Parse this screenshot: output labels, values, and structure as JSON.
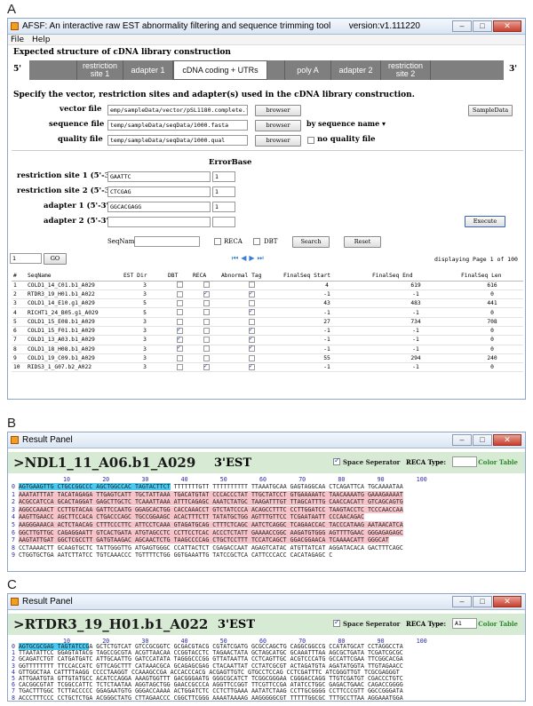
{
  "panel_labels": {
    "a": "A",
    "b": "B",
    "c": "C"
  },
  "afsf": {
    "title": "AFSF: An interactive raw EST abnormality filtering and sequence trimming tool",
    "version": "version:v1.111220",
    "menu": [
      "File",
      "Help"
    ],
    "expected_heading": "Expected structure of cDNA library construction",
    "five_prime": "5'",
    "three_prime": "3'",
    "segments": [
      "restriction site 1",
      "adapter 1",
      "cDNA coding + UTRs",
      "poly A",
      "adapter 2",
      "restriction site 2"
    ],
    "specify_heading": "Specify the vector, restriction sites and adapter(s) used in the cDNA library construction.",
    "vector_label": "vector file",
    "vector_value": "emp/sampleData/vector/pSL1180.complete.fasta",
    "sequence_label": "sequence file",
    "sequence_value": "temp/sampleData/seqData/1000.fasta",
    "quality_label": "quality file",
    "quality_value": "temp/sampleData/seqData/1000.qual",
    "browser": "browser",
    "by_name": "by sequence name",
    "no_quality": "no quality file",
    "sample_data": "SampleData",
    "errorbase": "ErrorBase",
    "rs1_label": "restriction site 1 (5'-3')",
    "rs1_value": "GAATTC",
    "rs1_err": "1",
    "rs2_label": "restriction site 2 (5'-3')",
    "rs2_value": "CTCGAG",
    "rs2_err": "1",
    "ad1_label": "adapter 1 (5'-3')",
    "ad1_value": "GGCACGAGG",
    "ad1_err": "1",
    "ad2_label": "adapter 2 (5'-3')",
    "execute": "Execute",
    "seqname_label": "SeqName",
    "reca": "RECA",
    "dbt": "DBT",
    "search": "Search",
    "reset": "Reset",
    "page_input": "1",
    "go": "GO",
    "display_info": "displaying Page 1 of 100",
    "columns": [
      "#",
      "SeqName",
      "EST Dir",
      "DBT",
      "RECA",
      "Abnormal Tag",
      "FinalSeq Start",
      "FinalSeq End",
      "FinalSeq Len"
    ],
    "rows": [
      {
        "n": "1",
        "name": "COLD1_14_C01.b1_A029",
        "dir": "3",
        "dbt": false,
        "reca": false,
        "ab": false,
        "start": "4",
        "end": "619",
        "len": "616"
      },
      {
        "n": "2",
        "name": "RTDR3_19_H01.b1_A022",
        "dir": "3",
        "dbt": false,
        "reca": true,
        "ab": true,
        "start": "-1",
        "end": "-1",
        "len": "0"
      },
      {
        "n": "3",
        "name": "COLD1_14_E10.g1_A029",
        "dir": "5",
        "dbt": false,
        "reca": false,
        "ab": false,
        "start": "43",
        "end": "483",
        "len": "441"
      },
      {
        "n": "4",
        "name": "RICHT1_24_B05.g1_A029",
        "dir": "5",
        "dbt": false,
        "reca": false,
        "ab": true,
        "start": "-1",
        "end": "-1",
        "len": "0"
      },
      {
        "n": "5",
        "name": "COLD1_15_E08.b1_A029",
        "dir": "3",
        "dbt": false,
        "reca": false,
        "ab": false,
        "start": "27",
        "end": "734",
        "len": "708"
      },
      {
        "n": "6",
        "name": "COLD1_15_F01.b1_A029",
        "dir": "3",
        "dbt": true,
        "reca": false,
        "ab": true,
        "start": "-1",
        "end": "-1",
        "len": "0"
      },
      {
        "n": "7",
        "name": "COLD1_13_A03.b1_A029",
        "dir": "3",
        "dbt": true,
        "reca": false,
        "ab": true,
        "start": "-1",
        "end": "-1",
        "len": "0"
      },
      {
        "n": "8",
        "name": "COLD1_18_H08.b1_A029",
        "dir": "3",
        "dbt": true,
        "reca": false,
        "ab": true,
        "start": "-1",
        "end": "-1",
        "len": "0"
      },
      {
        "n": "9",
        "name": "COLD1_19_C09.b1_A029",
        "dir": "3",
        "dbt": false,
        "reca": false,
        "ab": false,
        "start": "55",
        "end": "294",
        "len": "240"
      },
      {
        "n": "10",
        "name": "RIDS3_1_G07.b2_A022",
        "dir": "3",
        "dbt": false,
        "reca": true,
        "ab": true,
        "start": "-1",
        "end": "-1",
        "len": "0"
      }
    ]
  },
  "result_b": {
    "window_title": "Result Panel",
    "seq_name": ">NDL1_11_A06.b1_A029",
    "est": "3'EST",
    "space_sep": "Space Seperator",
    "reca_type": "RECA Type:",
    "reca_value": "",
    "color_table": "Color Table",
    "ruler": [
      "10",
      "20",
      "30",
      "40",
      "50",
      "60",
      "70",
      "80",
      "90",
      "100"
    ],
    "lines": [
      "AGTGAAGTTG CTGCCGGCCC AGCTGGCCAC TAGTACTTCT TTTTTTTGTT TTTTTTTTTT TTAAATGCAA GAGTAGGCAA CTCAGATTCA TGCAAAATAA",
      "AAATATTTAT TACATAGAGA TTGAGTCATT TGCTATTAAA TGACATGTAT CCCACCCTAT TTGCTATCCT GTGAAAAATC TAACAAAATG GAAAGAAAAT",
      "ACGCCATCCA GCACTAGGAT GAGCTTGCTC TCAAATTAAA ATTTCAGAGC AAATCTATGC TAAGATTTGT TTAGCATTTG CAACCACATT GTCAGCAGTG",
      "AGGCCAAACT CCTTGTACAA GATTCCAATG GGAGCACTGG CACCAAACCT GTCTATCCCA ACAGCCTTTC CCTTGGATCC TAAGTACCTC TCCCAACCAA",
      "AAGTTGAACC AGCTTCCACA CTGACCCAGC TGCCGGAAGC ACACTTTCTT TATATGCTGG AGTTTGTTCC TCGAATAATT CCCAACAGAC",
      "AAGGGAAACA ACTCTAACAG CTTTCCCTTC ATTCCTCAAA GTAGATGCAG CTTTCTCAGC AATCTCAGGC TCAGAACCAC TACCCATAAG AATAACATCA",
      "GGCTTGTTGC CAGAGGAATT GTCACTGATA ATGTAGCCTC CCTTCCTCAC ACCCTCTATT GAAAACCGGC AAGATGTGGG AGTTTTGAAC GGGAGAGAGC",
      "AAGTATTGAT GGCTCGCCTT GATGTAAGAC AGCAACTCTG TAAGCCCCAG CTGCTCCTTT TCCATCAGCT GGACGGAACA TCAAAACATT GGGCAT",
      "CCTAAAACTT GCAAGTGCTC TATTGGGTTG ATGAGTGGGC CCATTACTCT CGAGACCAAT AGAGTCATAC ATGTTATCAT AGGATACACA GACTTTCAGC",
      "CTGGTGCTGA AATCTTATCC TGTCAAACCC TGTTTTCTGG GGTGAAATTG TATCCGCTCA CATTCCCACC CACATAGAGC C"
    ]
  },
  "result_c": {
    "window_title": "Result Panel",
    "seq_name": ">RTDR3_19_H01.b1_A022",
    "est": "3'EST",
    "space_sep": "Space Seperator",
    "reca_type": "RECA Type:",
    "reca_value": "A1",
    "color_table": "Color Table",
    "ruler": [
      "10",
      "20",
      "30",
      "40",
      "50",
      "60",
      "70",
      "80",
      "90",
      "100"
    ],
    "lines": [
      "AGTGCGCGAG TAGTATCCGA GCTCTGTCAT GTCCGCGGTC GCGACGTACG CGTATCGATG GCGCCAGCTG CAGGCGGCCG CCATATGCAT CCTAGGCCTA",
      "TTAATATTCC GGAGTATACG TAGCCGCGTA ACGTTAACAA CCGGTACCTC TAGAACTATA GCTAGCATGC GCAAATTTAA AGCGCTGATA TCGATCGCGC",
      "GCAGATCTGT CATGATGATC ATTGCAATTG GATCCATATA TAGGGCCCGG GTTATAATTA CCTCAGTTGC ACGTCCCATG GCCATTCGAA TTCGGCACGA",
      "GGTTTTTTTT TTCCACCATC GTTCAGCTTT CATAAACGCA GCAGAGCGAG CTACAATTAT CCTATCGCGT ACTAGATGTA AGATATGGTA TTGTAGAACC",
      "GTTGGCTAA CATTTTAAGG CCCCTAAGGT CCAAAGCCGA ACCACCCACG ACGAGTTGTC GTGCCTCCAG CCTCGATTTC ATCGGGTTGT TCGCGAGGGT",
      "ATTGAATGTA GTTGTATGCC ACATCCAGGA AAAGTGGTTT GACGGGAATG GGGCGCATCT TCGGCGGGAA CGGGACCAGG TTGTCGATGT CGACCCTGTC",
      "CACGGCGTAT TCGGCCATTC TCTCTAATAA AGGTAGCTGG GAACCGCCCA AGGTTCCGGT TTCGTTCCGA ATATCCTGGC GAGACTGAAC CAGACCGGGG",
      "TGACTTTGGC TCTTACCCCC GGAGAATGTG GGGACCAAAA ACTGGATCTC CCTCTTGAAA AATATCTAAG CCTTGCGGGG CCTTCCCGTT GGCCGGGATA",
      "ACCCTTTCCC CCTGCTCTGA ACGGGCTATG CTTAGAACCC CGGCTTCGGG AAAATAAAAG AAGGGGGCGT TTTTTGGCGC TTTGCCTTAA AGGAAATGGA",
      "AACGGGGCCC ATGGGAAAAC CACCGCAAAG GCCCCCTAA"
    ]
  }
}
